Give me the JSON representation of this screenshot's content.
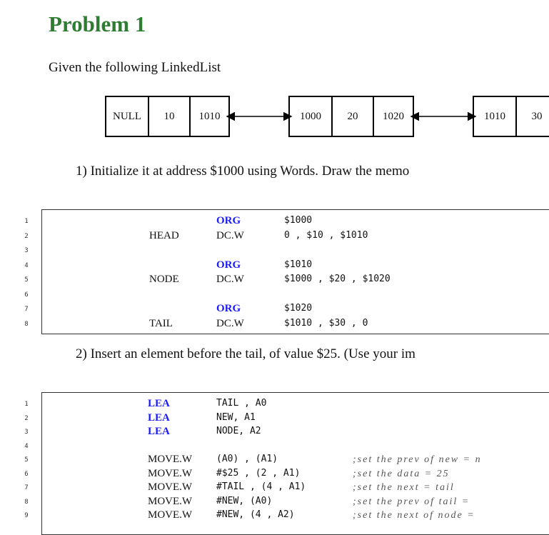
{
  "document": {
    "title": "Problem 1",
    "intro": "Given the following LinkedList",
    "nodes": [
      [
        "NULL",
        "10",
        "1010"
      ],
      [
        "1000",
        "20",
        "1020"
      ],
      [
        "1010",
        "30"
      ]
    ],
    "step1": "1) Initialize it at address $1000 using Words. Draw the memo",
    "step2": "2) Insert an element before the tail, of value $25. (Use your im"
  },
  "code1": {
    "line_numbers": [
      "1",
      "2",
      "3",
      "4",
      "5",
      "6",
      "7",
      "8"
    ],
    "lines": [
      {
        "label": "",
        "op": "ORG",
        "args": "$1000"
      },
      {
        "label": "HEAD",
        "op": "DC.W",
        "args": "0 , $10 , $1010"
      },
      {
        "label": "",
        "op": "",
        "args": ""
      },
      {
        "label": "",
        "op": "ORG",
        "args": "$1010"
      },
      {
        "label": "NODE",
        "op": "DC.W",
        "args": "$1000 , $20 , $1020"
      },
      {
        "label": "",
        "op": "",
        "args": ""
      },
      {
        "label": "",
        "op": "ORG",
        "args": "$1020"
      },
      {
        "label": "TAIL",
        "op": "DC.W",
        "args": "$1010 , $30 , 0"
      }
    ]
  },
  "code2": {
    "line_numbers": [
      "1",
      "2",
      "3",
      "4",
      "5",
      "6",
      "7",
      "8",
      "9"
    ],
    "lines": [
      {
        "op": "LEA",
        "args": "TAIL , A0",
        "comment": ""
      },
      {
        "op": "LEA",
        "args": "NEW, A1",
        "comment": ""
      },
      {
        "op": "LEA",
        "args": "NODE, A2",
        "comment": ""
      },
      {
        "op": "",
        "args": "",
        "comment": ""
      },
      {
        "op": "MOVE.W",
        "args": "(A0) , (A1)",
        "comment": ";set the prev of new = n"
      },
      {
        "op": "MOVE.W",
        "args": "#$25 , (2 , A1)",
        "comment": ";set the data = 25"
      },
      {
        "op": "MOVE.W",
        "args": "#TAIL , (4 , A1)",
        "comment": ";set the next = tail"
      },
      {
        "op": "MOVE.W",
        "args": "#NEW, (A0)",
        "comment": ";set the prev of tail ="
      },
      {
        "op": "MOVE.W",
        "args": "#NEW, (4 , A2)",
        "comment": ";set the next of node ="
      }
    ]
  }
}
